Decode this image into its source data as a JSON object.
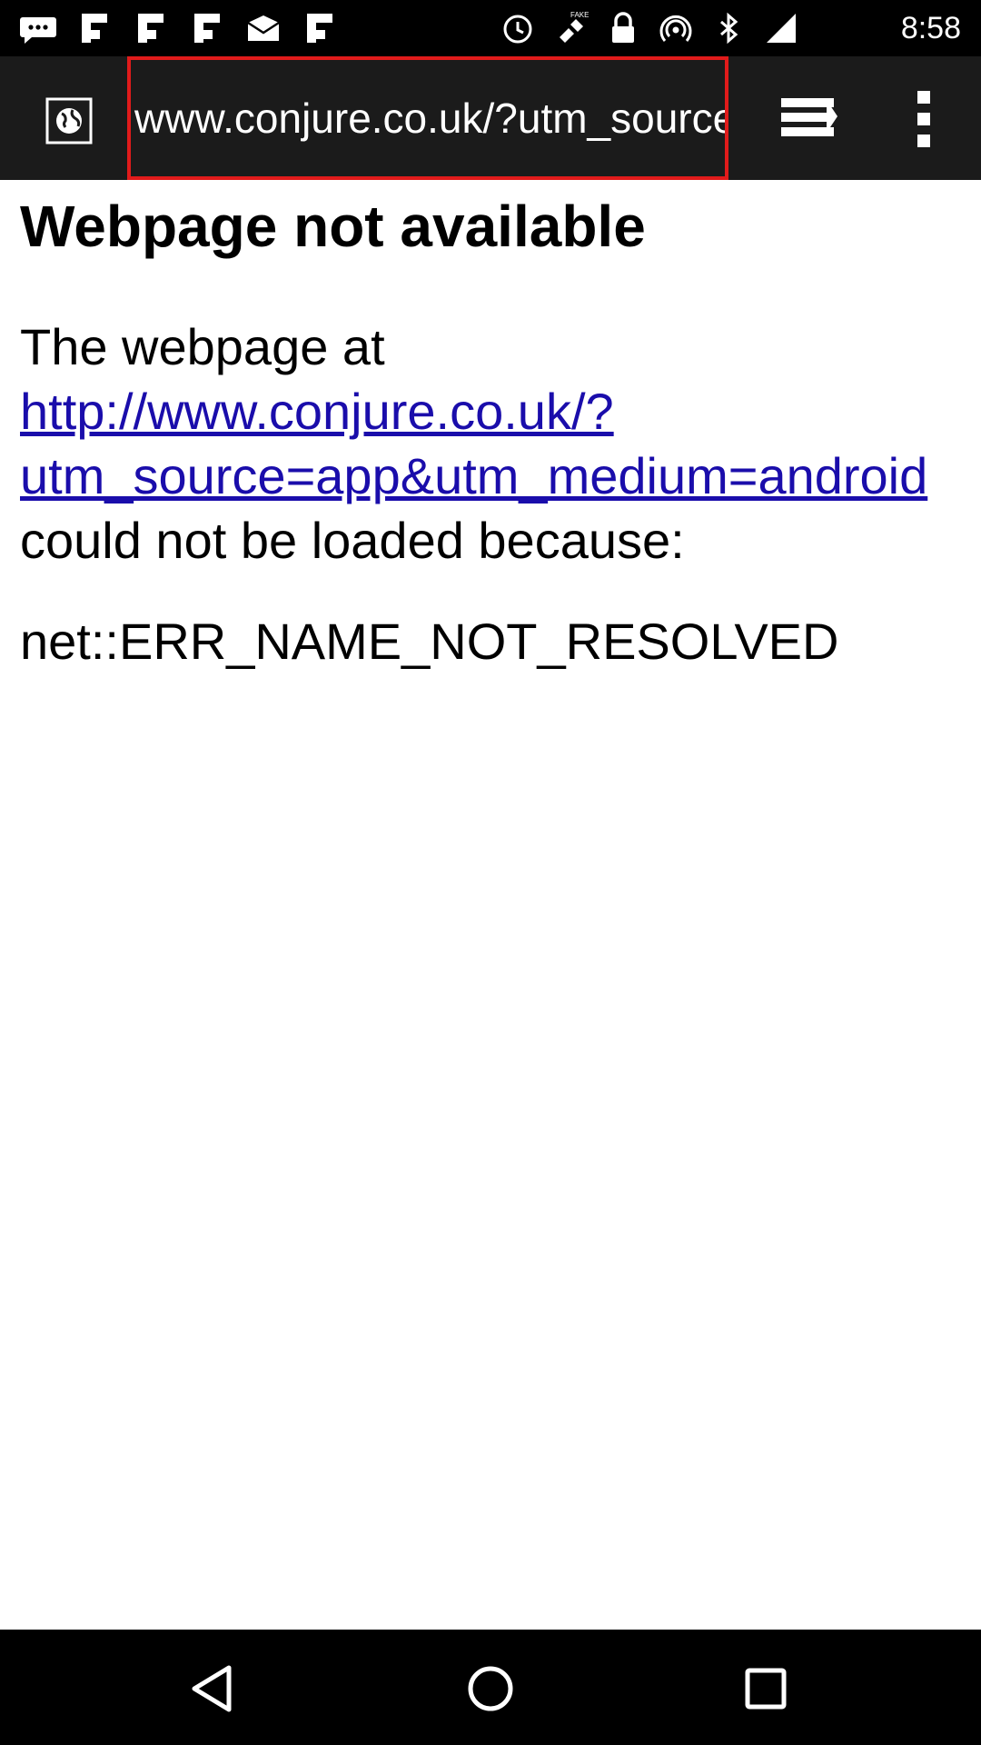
{
  "status_bar": {
    "time": "8:58",
    "left_icons": [
      "messages-icon",
      "flipboard-icon",
      "flipboard-icon",
      "flipboard-icon",
      "email-icon",
      "flipboard-icon"
    ],
    "right_icons": [
      "alarm-icon",
      "fake-gps-icon",
      "lock-icon",
      "hotspot-icon",
      "bluetooth-icon",
      "signal-icon"
    ]
  },
  "toolbar": {
    "url": "www.conjure.co.uk/?utm_source=app&utm_medium=android",
    "highlight_color": "#e11b1b"
  },
  "page": {
    "title": "Webpage not available",
    "intro": "The webpage at",
    "link_line1": "http://www.conjure.co.uk/?",
    "link_line2": "utm_source=app&utm_medium=android",
    "suffix": "could not be loaded because:",
    "error_code": "net::ERR_NAME_NOT_RESOLVED",
    "link_color": "#1a0dab"
  },
  "nav_bar": {
    "buttons": [
      "back-icon",
      "home-icon",
      "recent-apps-icon"
    ]
  }
}
